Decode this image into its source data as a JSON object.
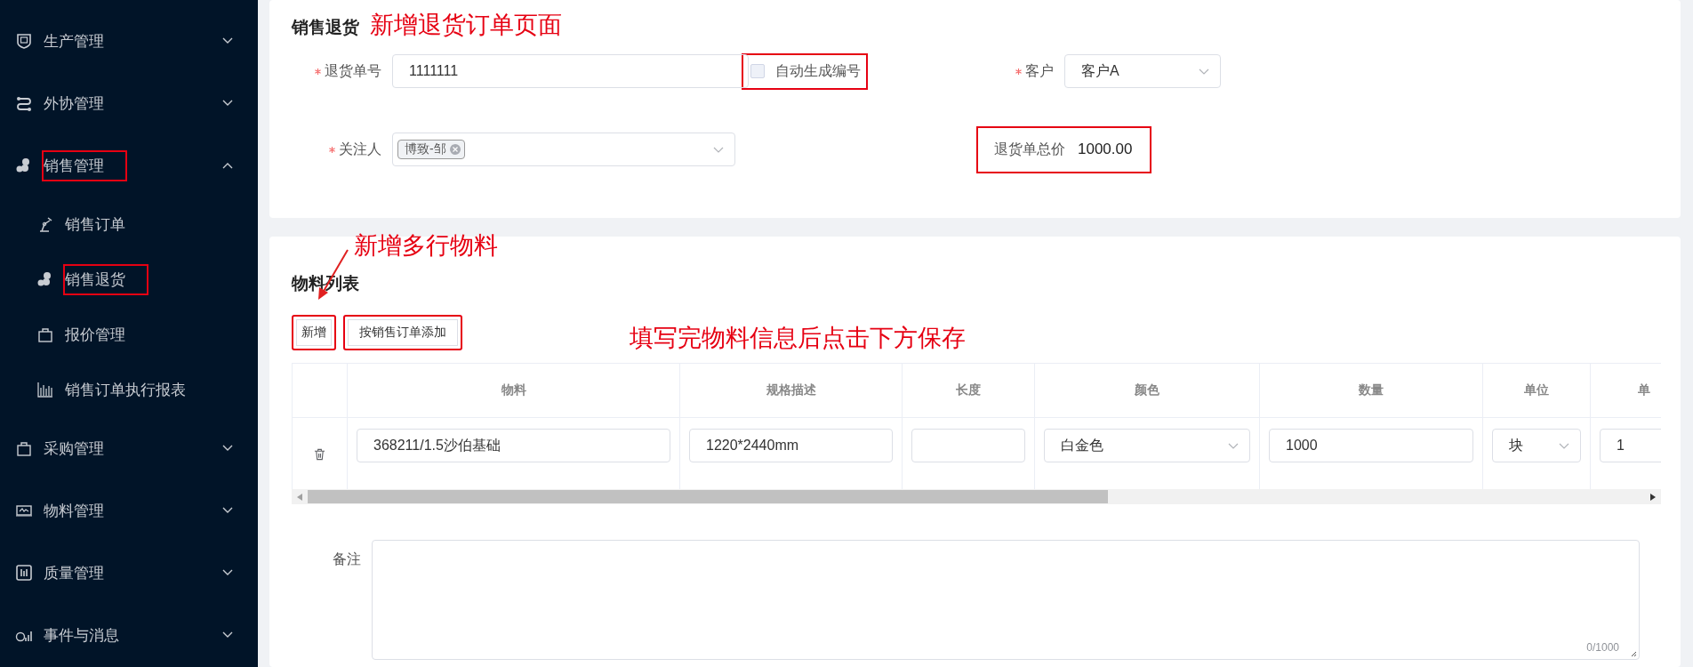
{
  "sidebar": {
    "items": [
      {
        "label": "生产管理",
        "expanded": false,
        "highlighted": false
      },
      {
        "label": "外协管理",
        "expanded": false,
        "highlighted": false
      },
      {
        "label": "销售管理",
        "expanded": true,
        "highlighted": true,
        "children": [
          {
            "label": "销售订单",
            "highlighted": false
          },
          {
            "label": "销售退货",
            "highlighted": true
          },
          {
            "label": "报价管理",
            "highlighted": false
          },
          {
            "label": "销售订单执行报表",
            "highlighted": false
          }
        ]
      },
      {
        "label": "采购管理",
        "expanded": false,
        "highlighted": false
      },
      {
        "label": "物料管理",
        "expanded": false,
        "highlighted": false
      },
      {
        "label": "质量管理",
        "expanded": false,
        "highlighted": false
      },
      {
        "label": "事件与消息",
        "expanded": false,
        "highlighted": false
      }
    ]
  },
  "header": {
    "title": "销售退货",
    "annotation": "新增退货订单页面"
  },
  "form": {
    "return_no": {
      "label": "退货单号",
      "required": true,
      "value": "1111111"
    },
    "auto_number": {
      "label": "自动生成编号",
      "checked": false,
      "highlighted": true
    },
    "customer": {
      "label": "客户",
      "required": true,
      "value": "客户A"
    },
    "watchers": {
      "label": "关注人",
      "required": true,
      "tags": [
        "博致-邹"
      ]
    },
    "total": {
      "label": "退货单总价",
      "value": "1000.00",
      "highlighted": true
    }
  },
  "materials": {
    "title": "物料列表",
    "annotation": "新增多行物料",
    "hint": "填写完物料信息后点击下方保存",
    "buttons": [
      {
        "label": "新增",
        "highlighted": true
      },
      {
        "label": "按销售订单添加",
        "highlighted": true
      }
    ],
    "columns": [
      "物料",
      "规格描述",
      "长度",
      "颜色",
      "数量",
      "单位",
      "单"
    ],
    "rows": [
      {
        "cells": [
          {
            "kind": "input",
            "value": "368211/1.5沙伯基础"
          },
          {
            "kind": "input",
            "value": "1220*2440mm"
          },
          {
            "kind": "input"
          },
          {
            "kind": "select",
            "value": "白金色"
          },
          {
            "kind": "input",
            "value": "1000"
          },
          {
            "kind": "select",
            "value": "块"
          },
          {
            "kind": "input",
            "value": "1"
          }
        ]
      }
    ]
  },
  "remark": {
    "label": "备注",
    "counter": "0/1000"
  }
}
